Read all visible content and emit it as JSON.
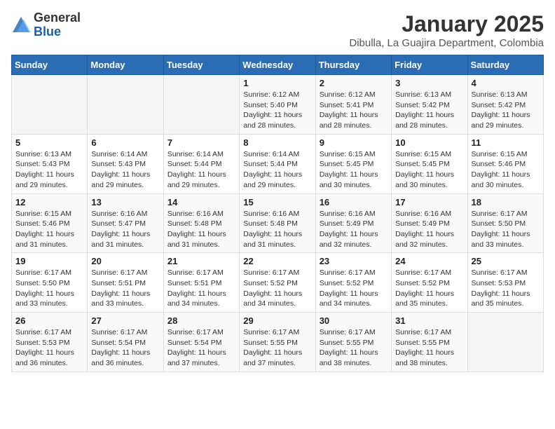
{
  "logo": {
    "general": "General",
    "blue": "Blue"
  },
  "header": {
    "month": "January 2025",
    "location": "Dibulla, La Guajira Department, Colombia"
  },
  "weekdays": [
    "Sunday",
    "Monday",
    "Tuesday",
    "Wednesday",
    "Thursday",
    "Friday",
    "Saturday"
  ],
  "weeks": [
    [
      {
        "day": "",
        "info": ""
      },
      {
        "day": "",
        "info": ""
      },
      {
        "day": "",
        "info": ""
      },
      {
        "day": "1",
        "info": "Sunrise: 6:12 AM\nSunset: 5:40 PM\nDaylight: 11 hours and 28 minutes."
      },
      {
        "day": "2",
        "info": "Sunrise: 6:12 AM\nSunset: 5:41 PM\nDaylight: 11 hours and 28 minutes."
      },
      {
        "day": "3",
        "info": "Sunrise: 6:13 AM\nSunset: 5:42 PM\nDaylight: 11 hours and 28 minutes."
      },
      {
        "day": "4",
        "info": "Sunrise: 6:13 AM\nSunset: 5:42 PM\nDaylight: 11 hours and 29 minutes."
      }
    ],
    [
      {
        "day": "5",
        "info": "Sunrise: 6:13 AM\nSunset: 5:43 PM\nDaylight: 11 hours and 29 minutes."
      },
      {
        "day": "6",
        "info": "Sunrise: 6:14 AM\nSunset: 5:43 PM\nDaylight: 11 hours and 29 minutes."
      },
      {
        "day": "7",
        "info": "Sunrise: 6:14 AM\nSunset: 5:44 PM\nDaylight: 11 hours and 29 minutes."
      },
      {
        "day": "8",
        "info": "Sunrise: 6:14 AM\nSunset: 5:44 PM\nDaylight: 11 hours and 29 minutes."
      },
      {
        "day": "9",
        "info": "Sunrise: 6:15 AM\nSunset: 5:45 PM\nDaylight: 11 hours and 30 minutes."
      },
      {
        "day": "10",
        "info": "Sunrise: 6:15 AM\nSunset: 5:45 PM\nDaylight: 11 hours and 30 minutes."
      },
      {
        "day": "11",
        "info": "Sunrise: 6:15 AM\nSunset: 5:46 PM\nDaylight: 11 hours and 30 minutes."
      }
    ],
    [
      {
        "day": "12",
        "info": "Sunrise: 6:15 AM\nSunset: 5:46 PM\nDaylight: 11 hours and 31 minutes."
      },
      {
        "day": "13",
        "info": "Sunrise: 6:16 AM\nSunset: 5:47 PM\nDaylight: 11 hours and 31 minutes."
      },
      {
        "day": "14",
        "info": "Sunrise: 6:16 AM\nSunset: 5:48 PM\nDaylight: 11 hours and 31 minutes."
      },
      {
        "day": "15",
        "info": "Sunrise: 6:16 AM\nSunset: 5:48 PM\nDaylight: 11 hours and 31 minutes."
      },
      {
        "day": "16",
        "info": "Sunrise: 6:16 AM\nSunset: 5:49 PM\nDaylight: 11 hours and 32 minutes."
      },
      {
        "day": "17",
        "info": "Sunrise: 6:16 AM\nSunset: 5:49 PM\nDaylight: 11 hours and 32 minutes."
      },
      {
        "day": "18",
        "info": "Sunrise: 6:17 AM\nSunset: 5:50 PM\nDaylight: 11 hours and 33 minutes."
      }
    ],
    [
      {
        "day": "19",
        "info": "Sunrise: 6:17 AM\nSunset: 5:50 PM\nDaylight: 11 hours and 33 minutes."
      },
      {
        "day": "20",
        "info": "Sunrise: 6:17 AM\nSunset: 5:51 PM\nDaylight: 11 hours and 33 minutes."
      },
      {
        "day": "21",
        "info": "Sunrise: 6:17 AM\nSunset: 5:51 PM\nDaylight: 11 hours and 34 minutes."
      },
      {
        "day": "22",
        "info": "Sunrise: 6:17 AM\nSunset: 5:52 PM\nDaylight: 11 hours and 34 minutes."
      },
      {
        "day": "23",
        "info": "Sunrise: 6:17 AM\nSunset: 5:52 PM\nDaylight: 11 hours and 34 minutes."
      },
      {
        "day": "24",
        "info": "Sunrise: 6:17 AM\nSunset: 5:52 PM\nDaylight: 11 hours and 35 minutes."
      },
      {
        "day": "25",
        "info": "Sunrise: 6:17 AM\nSunset: 5:53 PM\nDaylight: 11 hours and 35 minutes."
      }
    ],
    [
      {
        "day": "26",
        "info": "Sunrise: 6:17 AM\nSunset: 5:53 PM\nDaylight: 11 hours and 36 minutes."
      },
      {
        "day": "27",
        "info": "Sunrise: 6:17 AM\nSunset: 5:54 PM\nDaylight: 11 hours and 36 minutes."
      },
      {
        "day": "28",
        "info": "Sunrise: 6:17 AM\nSunset: 5:54 PM\nDaylight: 11 hours and 37 minutes."
      },
      {
        "day": "29",
        "info": "Sunrise: 6:17 AM\nSunset: 5:55 PM\nDaylight: 11 hours and 37 minutes."
      },
      {
        "day": "30",
        "info": "Sunrise: 6:17 AM\nSunset: 5:55 PM\nDaylight: 11 hours and 38 minutes."
      },
      {
        "day": "31",
        "info": "Sunrise: 6:17 AM\nSunset: 5:55 PM\nDaylight: 11 hours and 38 minutes."
      },
      {
        "day": "",
        "info": ""
      }
    ]
  ]
}
